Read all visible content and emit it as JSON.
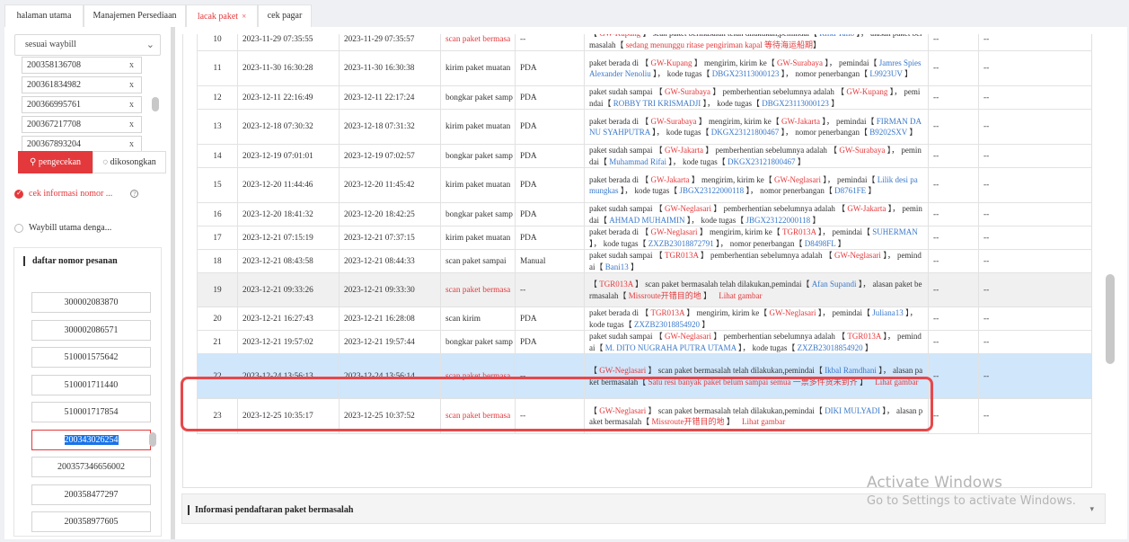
{
  "tabs": [
    {
      "label": "halaman utama",
      "active": false
    },
    {
      "label": "Manajemen Persediaan",
      "active": false
    },
    {
      "label": "lacak paket",
      "active": true,
      "close": "×"
    },
    {
      "label": "cek pagar",
      "active": false
    }
  ],
  "left": {
    "select_value": "sesuai waybill",
    "select_icon": "chevron-down-icon",
    "waybills": [
      "200358136708",
      "200361834982",
      "200366995761",
      "200367217708",
      "200367893204"
    ],
    "remove_glyph": "x",
    "search_button": "pengecekan",
    "clear_button": "dikosongkan",
    "option_check": "cek informasi nomor ...",
    "option_waybill": "Waybill utama denga...",
    "order_title": "daftar nomor pesanan",
    "orders": [
      "300002083870",
      "300002086571",
      "510001575642",
      "510001711440",
      "510001717854",
      "200343026254",
      "200357346656002",
      "200358477297",
      "200358977605"
    ],
    "selected_order_index": 5
  },
  "rows": [
    {
      "no": "10",
      "t1": "2023-11-29 07:35:55",
      "t2": "2023-11-29 07:35:57",
      "type": "scan paket bermasa",
      "type_red": true,
      "dev": "--",
      "gray": false,
      "hl": false,
      "desc": [
        [
          "t",
          "【 "
        ],
        [
          "r",
          "GW-Kupang"
        ],
        [
          "t",
          " 】 scan paket bermasalah telah dilakukan,pemindai【 "
        ],
        [
          "b",
          "Rifki Talib"
        ],
        [
          "t",
          " 】， alasan paket bermasalah【 "
        ],
        [
          "r",
          "sedang menunggu ritase pengiriman kapal 等待海运船期"
        ],
        [
          "t",
          "】"
        ]
      ]
    },
    {
      "no": "11",
      "t1": "2023-11-30 16:30:28",
      "t2": "2023-11-30 16:30:38",
      "type": "kirim paket muatan",
      "type_red": false,
      "dev": "PDA",
      "gray": false,
      "hl": false,
      "desc": [
        [
          "t",
          "paket berada di 【 "
        ],
        [
          "r",
          "GW-Kupang"
        ],
        [
          "t",
          " 】 mengirim, kirim ke【 "
        ],
        [
          "r",
          "GW-Surabaya"
        ],
        [
          "t",
          " 】， pemindai【 "
        ],
        [
          "b",
          "Jamres Spies Alexander Nenoliu"
        ],
        [
          "t",
          " 】， kode tugas【 "
        ],
        [
          "b",
          "DBGX23113000123"
        ],
        [
          "t",
          " 】， nomor penerbangan【 "
        ],
        [
          "b",
          "L9923UV"
        ],
        [
          "t",
          " 】"
        ]
      ]
    },
    {
      "no": "12",
      "t1": "2023-12-11 22:16:49",
      "t2": "2023-12-11 22:17:24",
      "type": "bongkar paket samp",
      "type_red": false,
      "dev": "PDA",
      "gray": false,
      "hl": false,
      "desc": [
        [
          "t",
          "paket sudah sampai 【 "
        ],
        [
          "r",
          "GW-Surabaya"
        ],
        [
          "t",
          " 】 pemberhentian sebelumnya adalah 【 "
        ],
        [
          "r",
          "GW-Kupang"
        ],
        [
          "t",
          " 】， pemindai【 "
        ],
        [
          "b",
          "ROBBY TRI KRISMADJI"
        ],
        [
          "t",
          " 】， kode tugas【 "
        ],
        [
          "b",
          "DBGX23113000123"
        ],
        [
          "t",
          " 】"
        ]
      ]
    },
    {
      "no": "13",
      "t1": "2023-12-18 07:30:32",
      "t2": "2023-12-18 07:31:32",
      "type": "kirim paket muatan",
      "type_red": false,
      "dev": "PDA",
      "gray": false,
      "hl": false,
      "desc": [
        [
          "t",
          "paket berada di 【 "
        ],
        [
          "r",
          "GW-Surabaya"
        ],
        [
          "t",
          " 】 mengirim, kirim ke【 "
        ],
        [
          "r",
          "GW-Jakarta"
        ],
        [
          "t",
          " 】， pemindai【 "
        ],
        [
          "b",
          "FIRMAN DANU SYAHPUTRA"
        ],
        [
          "t",
          " 】， kode tugas【 "
        ],
        [
          "b",
          "DKGX23121800467"
        ],
        [
          "t",
          " 】， nomor penerbangan【 "
        ],
        [
          "b",
          "B9202SXV"
        ],
        [
          "t",
          " 】"
        ]
      ]
    },
    {
      "no": "14",
      "t1": "2023-12-19 07:01:01",
      "t2": "2023-12-19 07:02:57",
      "type": "bongkar paket samp",
      "type_red": false,
      "dev": "PDA",
      "gray": false,
      "hl": false,
      "desc": [
        [
          "t",
          "paket sudah sampai 【 "
        ],
        [
          "r",
          "GW-Jakarta"
        ],
        [
          "t",
          " 】 pemberhentian sebelumnya adalah 【 "
        ],
        [
          "r",
          "GW-Surabaya"
        ],
        [
          "t",
          " 】， pemindai【 "
        ],
        [
          "b",
          "Muhammad Rifai"
        ],
        [
          "t",
          " 】， kode tugas【 "
        ],
        [
          "b",
          "DKGX23121800467"
        ],
        [
          "t",
          " 】"
        ]
      ]
    },
    {
      "no": "15",
      "t1": "2023-12-20 11:44:46",
      "t2": "2023-12-20 11:45:42",
      "type": "kirim paket muatan",
      "type_red": false,
      "dev": "PDA",
      "gray": false,
      "hl": false,
      "desc": [
        [
          "t",
          "paket berada di 【 "
        ],
        [
          "r",
          "GW-Jakarta"
        ],
        [
          "t",
          " 】 mengirim, kirim ke【 "
        ],
        [
          "r",
          "GW-Neglasari"
        ],
        [
          "t",
          " 】， pemindai【 "
        ],
        [
          "b",
          "Lilik desi pamungkas"
        ],
        [
          "t",
          " 】， kode tugas【 "
        ],
        [
          "b",
          "JBGX23122000118"
        ],
        [
          "t",
          " 】， nomor penerbangan【 "
        ],
        [
          "b",
          "D8761FE"
        ],
        [
          "t",
          " 】"
        ]
      ]
    },
    {
      "no": "16",
      "t1": "2023-12-20 18:41:32",
      "t2": "2023-12-20 18:42:25",
      "type": "bongkar paket samp",
      "type_red": false,
      "dev": "PDA",
      "gray": false,
      "hl": false,
      "desc": [
        [
          "t",
          "paket sudah sampai 【 "
        ],
        [
          "r",
          "GW-Neglasari"
        ],
        [
          "t",
          " 】 pemberhentian sebelumnya adalah 【 "
        ],
        [
          "r",
          "GW-Jakarta"
        ],
        [
          "t",
          " 】， pemindai【 "
        ],
        [
          "b",
          "AHMAD MUHAIMIN"
        ],
        [
          "t",
          " 】， kode tugas【 "
        ],
        [
          "b",
          "JBGX23122000118"
        ],
        [
          "t",
          " 】"
        ]
      ]
    },
    {
      "no": "17",
      "t1": "2023-12-21 07:15:19",
      "t2": "2023-12-21 07:37:15",
      "type": "kirim paket muatan",
      "type_red": false,
      "dev": "PDA",
      "gray": false,
      "hl": false,
      "desc": [
        [
          "t",
          "paket berada di 【 "
        ],
        [
          "r",
          "GW-Neglasari"
        ],
        [
          "t",
          " 】 mengirim, kirim ke【 "
        ],
        [
          "r",
          "TGR013A"
        ],
        [
          "t",
          " 】， pemindai【 "
        ],
        [
          "b",
          "SUHERMAN"
        ],
        [
          "t",
          " 】， kode tugas【 "
        ],
        [
          "b",
          "ZXZB23018872791"
        ],
        [
          "t",
          " 】， nomor penerbangan【 "
        ],
        [
          "b",
          "D8498FL"
        ],
        [
          "t",
          " 】"
        ]
      ]
    },
    {
      "no": "18",
      "t1": "2023-12-21 08:43:58",
      "t2": "2023-12-21 08:44:33",
      "type": "scan paket sampai",
      "type_red": false,
      "dev": "Manual",
      "gray": false,
      "hl": false,
      "desc": [
        [
          "t",
          "paket sudah sampai 【 "
        ],
        [
          "r",
          "TGR013A"
        ],
        [
          "t",
          " 】 pemberhentian sebelumnya adalah 【 "
        ],
        [
          "r",
          "GW-Neglasari"
        ],
        [
          "t",
          " 】， pemindai【 "
        ],
        [
          "b",
          "Bani13"
        ],
        [
          "t",
          " 】"
        ]
      ]
    },
    {
      "no": "19",
      "t1": "2023-12-21 09:33:26",
      "t2": "2023-12-21 09:33:30",
      "type": "scan paket bermasa",
      "type_red": true,
      "dev": "--",
      "gray": true,
      "hl": false,
      "desc": [
        [
          "t",
          "【 "
        ],
        [
          "r",
          "TGR013A"
        ],
        [
          "t",
          " 】 scan paket bermasalah telah dilakukan,pemindai【 "
        ],
        [
          "b",
          "Afan Supandi"
        ],
        [
          "t",
          " 】， alasan paket bermasalah【 "
        ],
        [
          "r",
          "Missroute开错目的地"
        ],
        [
          "t",
          " 】 "
        ],
        [
          "l",
          "Lihat gambar"
        ]
      ]
    },
    {
      "no": "20",
      "t1": "2023-12-21 16:27:43",
      "t2": "2023-12-21 16:28:08",
      "type": "scan kirim",
      "type_red": false,
      "dev": "PDA",
      "gray": false,
      "hl": false,
      "desc": [
        [
          "t",
          "paket berada di 【 "
        ],
        [
          "r",
          "TGR013A"
        ],
        [
          "t",
          " 】 mengirim, kirim ke【 "
        ],
        [
          "r",
          "GW-Neglasari"
        ],
        [
          "t",
          " 】， pemindai【 "
        ],
        [
          "b",
          "Juliana13"
        ],
        [
          "t",
          " 】， kode tugas【 "
        ],
        [
          "b",
          "ZXZB23018854920"
        ],
        [
          "t",
          " 】"
        ]
      ]
    },
    {
      "no": "21",
      "t1": "2023-12-21 19:57:02",
      "t2": "2023-12-21 19:57:44",
      "type": "bongkar paket samp",
      "type_red": false,
      "dev": "PDA",
      "gray": false,
      "hl": false,
      "desc": [
        [
          "t",
          "paket sudah sampai 【 "
        ],
        [
          "r",
          "GW-Neglasari"
        ],
        [
          "t",
          " 】 pemberhentian sebelumnya adalah 【 "
        ],
        [
          "r",
          "TGR013A"
        ],
        [
          "t",
          " 】， pemindai【 "
        ],
        [
          "b",
          "M. DITO NUGRAHA PUTRA UTAMA"
        ],
        [
          "t",
          " 】， kode tugas【 "
        ],
        [
          "b",
          "ZXZB23018854920"
        ],
        [
          "t",
          " 】"
        ]
      ]
    },
    {
      "no": "22",
      "t1": "2023-12-24 13:56:13",
      "t2": "2023-12-24 13:56:14",
      "type": "scan paket bermasa",
      "type_red": true,
      "dev": "--",
      "gray": false,
      "hl": true,
      "desc": [
        [
          "t",
          "【 "
        ],
        [
          "r",
          "GW-Neglasari"
        ],
        [
          "t",
          " 】 scan paket bermasalah telah dilakukan,pemindai【 "
        ],
        [
          "b",
          "Ikbal Ramdhani"
        ],
        [
          "t",
          " 】， alasan paket bermasalah【 "
        ],
        [
          "r",
          "Satu resi banyak paket belum sampai semua 一票多件货未到齐"
        ],
        [
          "t",
          " 】 "
        ],
        [
          "l",
          "Lihat gambar"
        ]
      ]
    },
    {
      "no": "23",
      "t1": "2023-12-25 10:35:17",
      "t2": "2023-12-25 10:37:52",
      "type": "scan paket bermasa",
      "type_red": true,
      "dev": "--",
      "gray": false,
      "hl": false,
      "desc": [
        [
          "t",
          "【 "
        ],
        [
          "r",
          "GW-Neglasari"
        ],
        [
          "t",
          " 】 scan paket bermasalah telah dilakukan,pemindai【 "
        ],
        [
          "b",
          "DIKI MULYADI"
        ],
        [
          "t",
          " 】， alasan paket bermasalah【 "
        ],
        [
          "r",
          "Missroute开错目的地"
        ],
        [
          "t",
          " 】 "
        ],
        [
          "l",
          "Lihat gambar"
        ]
      ]
    }
  ],
  "empty_cell": "--",
  "info_bar_title": "Informasi pendaftaran paket bermasalah",
  "info_bar_caret": "▾",
  "activate": {
    "line1": "Activate Windows",
    "line2": "Go to Settings to activate Windows."
  },
  "colors": {
    "accent": "#e4393c",
    "link": "#3a78c9",
    "highlight": "#cfe6fb",
    "frame": "#e8474a"
  }
}
